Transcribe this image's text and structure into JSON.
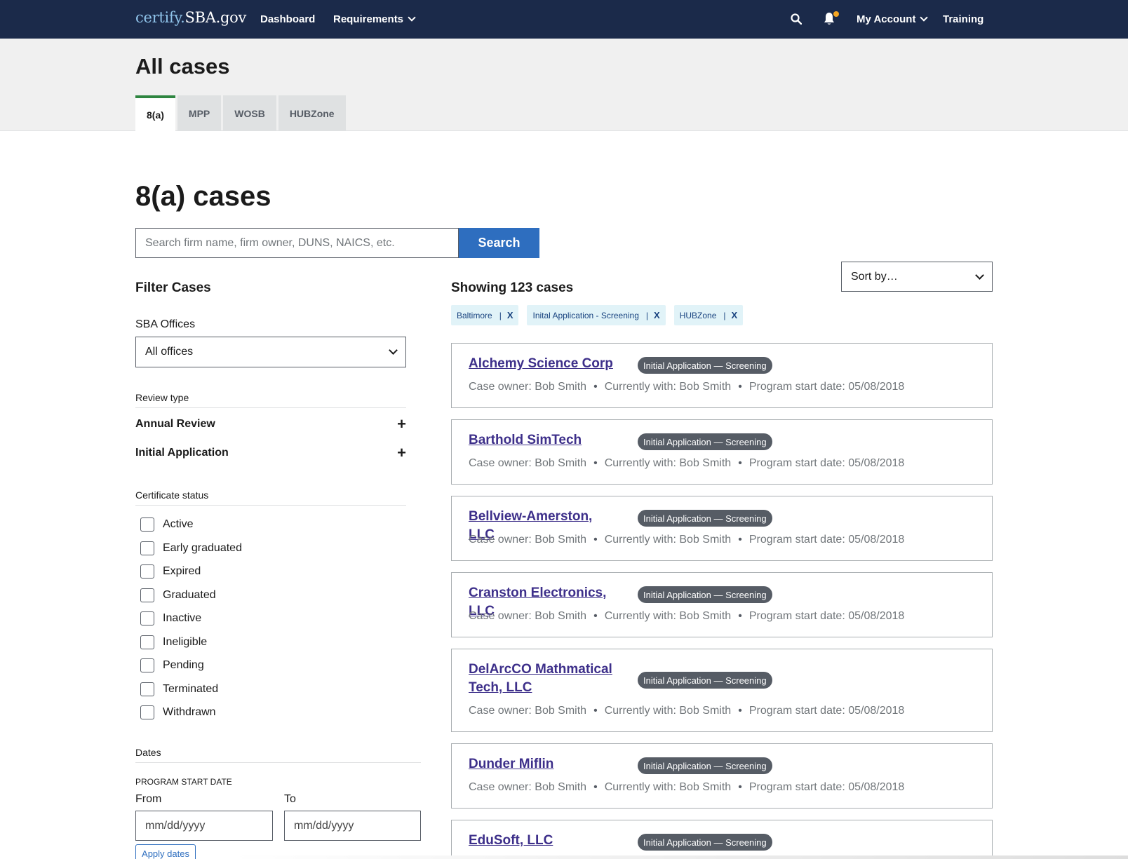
{
  "nav": {
    "logo_certify": "certify.",
    "logo_sba": "SBA.gov",
    "dashboard": "Dashboard",
    "requirements": "Requirements",
    "my_account": "My Account",
    "training": "Training"
  },
  "header": {
    "title": "All cases",
    "tabs": [
      "8(a)",
      "MPP",
      "WOSB",
      "HUBZone"
    ]
  },
  "main": {
    "section_title": "8(a) cases",
    "search_placeholder": "Search firm name, firm owner, DUNS, NAICS, etc.",
    "search_button": "Search",
    "sort_label": "Sort by…"
  },
  "filters": {
    "title": "Filter Cases",
    "offices_label": "SBA Offices",
    "offices_value": "All offices",
    "review_type_heading": "Review type",
    "review_types": [
      "Annual Review",
      "Initial Application"
    ],
    "cert_status_heading": "Certificate status",
    "statuses": [
      "Active",
      "Early graduated",
      "Expired",
      "Graduated",
      "Inactive",
      "Ineligible",
      "Pending",
      "Terminated",
      "Withdrawn"
    ],
    "dates_heading": "Dates",
    "program_start_date": "Program start date",
    "from_label": "From",
    "to_label": "To",
    "date_placeholder": "mm/dd/yyyy",
    "apply_button": "Apply dates"
  },
  "results": {
    "showing": "Showing 123 cases",
    "chips": [
      {
        "label": "Baltimore",
        "sep": "|",
        "x": "X"
      },
      {
        "label": "Inital Application - Screening",
        "sep": "|",
        "x": "X"
      },
      {
        "label": "HUBZone",
        "sep": "|",
        "x": "X"
      }
    ],
    "cases": [
      {
        "name": "Alchemy Science Corp",
        "status": "Initial Application — Screening",
        "owner": "Case owner: Bob Smith",
        "with": "Currently with: Bob Smith",
        "start": "Program start date: 05/08/2018"
      },
      {
        "name": "Barthold SimTech",
        "status": "Initial Application — Screening",
        "owner": "Case owner: Bob Smith",
        "with": "Currently with: Bob Smith",
        "start": "Program start date: 05/08/2018"
      },
      {
        "name": "Bellview-Amerston, LLC",
        "status": "Initial Application — Screening",
        "owner": "Case owner: Bob Smith",
        "with": "Currently with: Bob Smith",
        "start": "Program start date: 05/08/2018"
      },
      {
        "name": "Cranston Electronics, LLC",
        "status": "Initial Application — Screening",
        "owner": "Case owner: Bob Smith",
        "with": "Currently with: Bob Smith",
        "start": "Program start date: 05/08/2018"
      },
      {
        "name": "DelArcCO Mathmatical Tech, LLC",
        "status": "Initial Application — Screening",
        "owner": "Case owner: Bob Smith",
        "with": "Currently with: Bob Smith",
        "start": "Program start date: 05/08/2018"
      },
      {
        "name": "Dunder Miflin",
        "status": "Initial Application — Screening",
        "owner": "Case owner: Bob Smith",
        "with": "Currently with: Bob Smith",
        "start": "Program start date: 05/08/2018"
      },
      {
        "name": "EduSoft, LLC",
        "status": "Initial Application — Screening"
      }
    ],
    "bullet": "•"
  }
}
